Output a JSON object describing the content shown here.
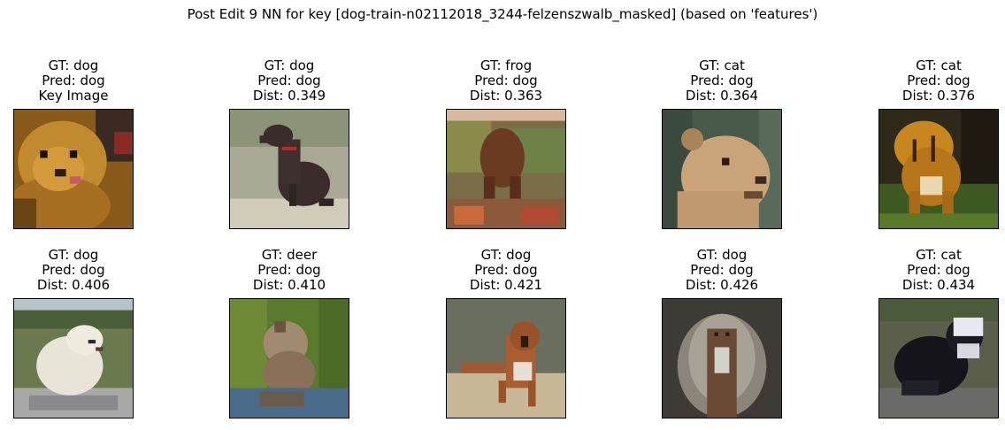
{
  "figure": {
    "title": "Post Edit 9 NN for key [dog-train-n02112018_3244-felzenszwalb_masked] (based on 'features')"
  },
  "panels": [
    {
      "gt": "GT: dog",
      "pred": "Pred: dog",
      "extra": "Key Image",
      "image": "pomeranian-dog-photo"
    },
    {
      "gt": "GT: dog",
      "pred": "Pred: dog",
      "extra": "Dist: 0.349",
      "image": "black-dog-sitting-photo"
    },
    {
      "gt": "GT: frog",
      "pred": "Pred: dog",
      "extra": "Dist: 0.363",
      "image": "blurry-brown-scene-photo"
    },
    {
      "gt": "GT: cat",
      "pred": "Pred: dog",
      "extra": "Dist: 0.364",
      "image": "lioness-head-photo"
    },
    {
      "gt": "GT: cat",
      "pred": "Pred: dog",
      "extra": "Dist: 0.376",
      "image": "tiger-walking-photo"
    },
    {
      "gt": "GT: dog",
      "pred": "Pred: dog",
      "extra": "Dist: 0.406",
      "image": "white-dog-on-rock-photo"
    },
    {
      "gt": "GT: deer",
      "pred": "Pred: dog",
      "extra": "Dist: 0.410",
      "image": "animal-in-grass-photo"
    },
    {
      "gt": "GT: dog",
      "pred": "Pred: dog",
      "extra": "Dist: 0.421",
      "image": "brown-boxer-dog-photo"
    },
    {
      "gt": "GT: dog",
      "pred": "Pred: dog",
      "extra": "Dist: 0.426",
      "image": "dog-front-view-photo"
    },
    {
      "gt": "GT: cat",
      "pred": "Pred: dog",
      "extra": "Dist: 0.434",
      "image": "black-white-cat-photo"
    }
  ]
}
